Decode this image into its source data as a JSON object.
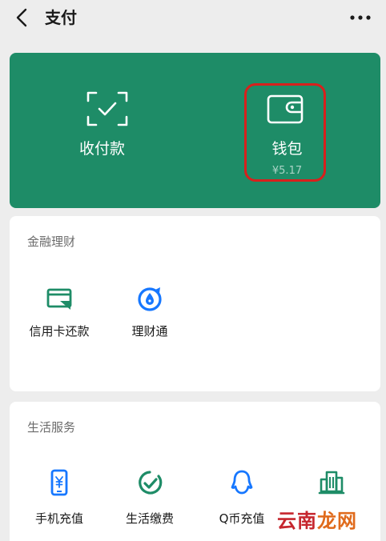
{
  "header": {
    "title": "支付",
    "back_icon": "chevron-left-icon",
    "more_icon": "ellipsis-icon"
  },
  "top_card": {
    "background": "#1e8c67",
    "receive_pay": {
      "label": "收付款",
      "icon": "scan-check-icon"
    },
    "wallet": {
      "label": "钱包",
      "balance": "¥5.17",
      "icon": "wallet-icon",
      "highlight_color": "#d8201c"
    }
  },
  "finance": {
    "title": "金融理财",
    "items": [
      {
        "label": "信用卡还款",
        "icon": "credit-card-icon"
      },
      {
        "label": "理财通",
        "icon": "wealth-drop-icon"
      }
    ]
  },
  "life": {
    "title": "生活服务",
    "items": [
      {
        "label": "手机充值",
        "icon": "phone-yen-icon"
      },
      {
        "label": "生活缴费",
        "icon": "check-circle-icon"
      },
      {
        "label": "Q币充值",
        "icon": "qq-penguin-icon"
      },
      {
        "label": "",
        "icon": "city-building-icon"
      }
    ]
  },
  "watermark": {
    "text_part1": "云南",
    "text_part2": "龙网"
  },
  "colors": {
    "accent_green": "#1e8c67",
    "icon_blue": "#1677ff",
    "highlight_red": "#d8201c"
  }
}
